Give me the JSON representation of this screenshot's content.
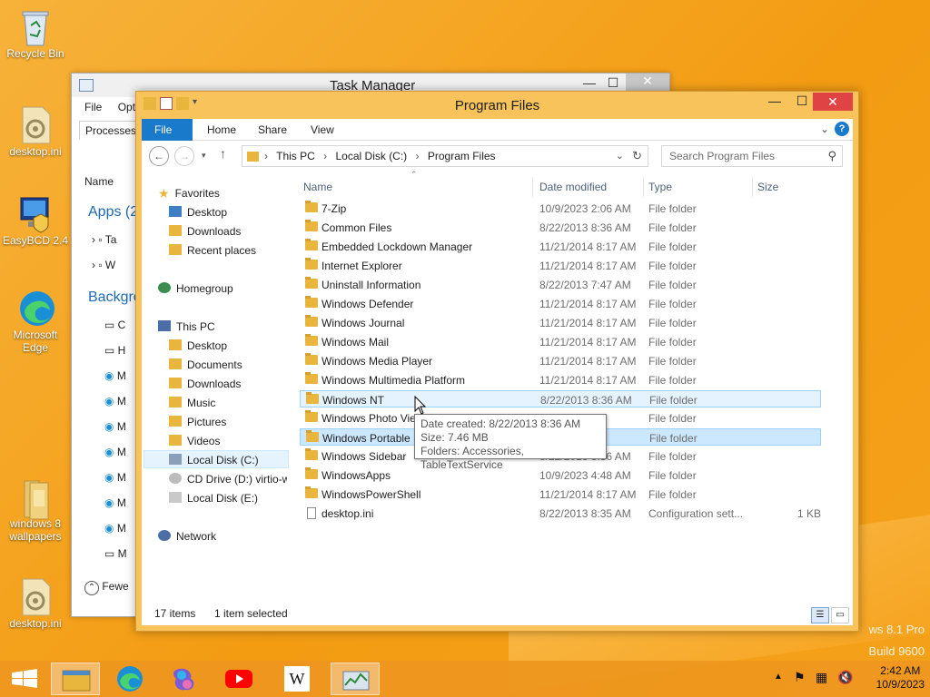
{
  "desktop": {
    "icons": [
      {
        "label": "Recycle Bin"
      },
      {
        "label": "desktop.ini"
      },
      {
        "label": "EasyBCD 2.4"
      },
      {
        "label": "Microsoft Edge"
      },
      {
        "label": "windows 8 wallpapers"
      },
      {
        "label": "desktop.ini"
      }
    ],
    "watermark_line1": "ws 8.1 Pro",
    "watermark_line2": "Build 9600"
  },
  "task_manager": {
    "title": "Task Manager",
    "menu": [
      "File",
      "Optio"
    ],
    "tab": "Processes",
    "name_header": "Name",
    "apps_group": "Apps (2",
    "background_group": "Backgro",
    "fewer_details": "Fewe",
    "truncated_rows": [
      "Ta",
      "W",
      "C",
      "H",
      "M",
      "M",
      "M",
      "M",
      "M",
      "M",
      "M",
      "M"
    ]
  },
  "explorer": {
    "title": "Program Files",
    "ribbon_tabs": [
      "File",
      "Home",
      "Share",
      "View"
    ],
    "address": {
      "crumbs": [
        "This PC",
        "Local Disk (C:)",
        "Program Files"
      ]
    },
    "search": {
      "placeholder": "Search Program Files"
    },
    "nav": {
      "favorites": "Favorites",
      "favorites_items": [
        "Desktop",
        "Downloads",
        "Recent places"
      ],
      "homegroup": "Homegroup",
      "this_pc": "This PC",
      "this_pc_items": [
        "Desktop",
        "Documents",
        "Downloads",
        "Music",
        "Pictures",
        "Videos",
        "Local Disk (C:)",
        "CD Drive (D:) virtio-w",
        "Local Disk (E:)"
      ],
      "network": "Network"
    },
    "columns": {
      "name": "Name",
      "date": "Date modified",
      "type": "Type",
      "size": "Size"
    },
    "files": [
      {
        "name": "7-Zip",
        "date": "10/9/2023 2:06 AM",
        "type": "File folder",
        "size": ""
      },
      {
        "name": "Common Files",
        "date": "8/22/2013 8:36 AM",
        "type": "File folder",
        "size": ""
      },
      {
        "name": "Embedded Lockdown Manager",
        "date": "11/21/2014 8:17 AM",
        "type": "File folder",
        "size": ""
      },
      {
        "name": "Internet Explorer",
        "date": "11/21/2014 8:17 AM",
        "type": "File folder",
        "size": ""
      },
      {
        "name": "Uninstall Information",
        "date": "8/22/2013 7:47 AM",
        "type": "File folder",
        "size": ""
      },
      {
        "name": "Windows Defender",
        "date": "11/21/2014 8:17 AM",
        "type": "File folder",
        "size": ""
      },
      {
        "name": "Windows Journal",
        "date": "11/21/2014 8:17 AM",
        "type": "File folder",
        "size": ""
      },
      {
        "name": "Windows Mail",
        "date": "11/21/2014 8:17 AM",
        "type": "File folder",
        "size": ""
      },
      {
        "name": "Windows Media Player",
        "date": "11/21/2014 8:17 AM",
        "type": "File folder",
        "size": ""
      },
      {
        "name": "Windows Multimedia Platform",
        "date": "11/21/2014 8:17 AM",
        "type": "File folder",
        "size": ""
      },
      {
        "name": "Windows NT",
        "date": "8/22/2013 8:36 AM",
        "type": "File folder",
        "size": ""
      },
      {
        "name": "Windows Photo Vie",
        "date": "17 AM",
        "type": "File folder",
        "size": ""
      },
      {
        "name": "Windows Portable D",
        "date": "17 AM",
        "type": "File folder",
        "size": ""
      },
      {
        "name": "Windows Sidebar",
        "date": "8/22/2013 8:36 AM",
        "type": "File folder",
        "size": ""
      },
      {
        "name": "WindowsApps",
        "date": "10/9/2023 4:48 AM",
        "type": "File folder",
        "size": ""
      },
      {
        "name": "WindowsPowerShell",
        "date": "11/21/2014 8:17 AM",
        "type": "File folder",
        "size": ""
      },
      {
        "name": "desktop.ini",
        "date": "8/22/2013 8:35 AM",
        "type": "Configuration sett...",
        "size": "1 KB"
      }
    ],
    "tooltip": {
      "line1": "Date created: 8/22/2013 8:36 AM",
      "line2": "Size: 7.46 MB",
      "line3": "Folders: Accessories, TableTextService"
    },
    "status": {
      "items": "17 items",
      "selected": "1 item selected"
    }
  },
  "taskbar": {
    "clock_time": "2:42 AM",
    "clock_date": "10/9/2023",
    "apps": [
      "start-icon",
      "file-explorer-icon",
      "edge-icon",
      "copilot-icon",
      "youtube-icon",
      "wikipedia-icon",
      "task-manager-icon"
    ]
  },
  "colors": {
    "accent": "#1979ca",
    "wallpaper": "#f39c12",
    "close_red": "#e04343",
    "selection": "#cce8ff"
  }
}
